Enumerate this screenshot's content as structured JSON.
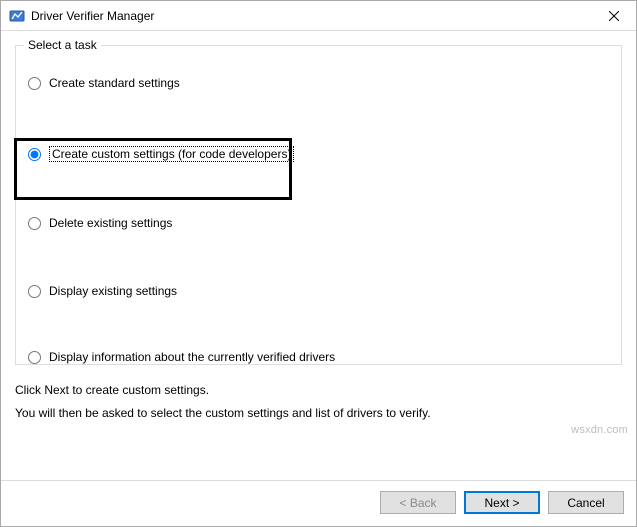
{
  "window": {
    "title": "Driver Verifier Manager"
  },
  "group": {
    "legend": "Select a task",
    "options": {
      "standard": "Create standard settings",
      "custom": "Create custom settings (for code developers)",
      "delete": "Delete existing settings",
      "display": "Display existing settings",
      "info": "Display information about the currently verified drivers"
    },
    "selected": "custom"
  },
  "instructions": {
    "line1": "Click Next to create custom settings.",
    "line2": "You will then be asked to select the custom settings and list of drivers to verify."
  },
  "buttons": {
    "back": "< Back",
    "next": "Next >",
    "cancel": "Cancel"
  },
  "watermark": "wsxdn.com"
}
